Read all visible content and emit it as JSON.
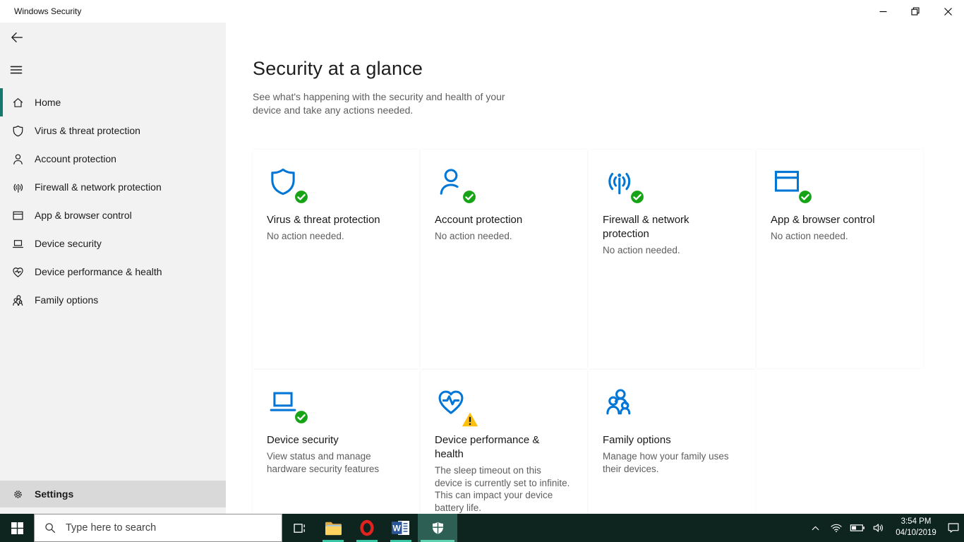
{
  "window": {
    "title": "Windows Security",
    "controls": [
      "minimize",
      "restore",
      "close"
    ]
  },
  "sidebar": {
    "items": [
      {
        "label": "Home",
        "icon": "home-icon",
        "selected": true
      },
      {
        "label": "Virus & threat protection",
        "icon": "shield-icon",
        "selected": false
      },
      {
        "label": "Account protection",
        "icon": "person-icon",
        "selected": false
      },
      {
        "label": "Firewall & network protection",
        "icon": "network-icon",
        "selected": false
      },
      {
        "label": "App & browser control",
        "icon": "app-browser-icon",
        "selected": false
      },
      {
        "label": "Device security",
        "icon": "laptop-icon",
        "selected": false
      },
      {
        "label": "Device performance & health",
        "icon": "health-heart-icon",
        "selected": false
      },
      {
        "label": "Family options",
        "icon": "family-icon",
        "selected": false
      }
    ],
    "settings": {
      "label": "Settings",
      "icon": "gear-icon"
    }
  },
  "main": {
    "title": "Security at a glance",
    "subtitle": "See what's happening with the security and health of your device and take any actions needed.",
    "tiles": [
      {
        "title": "Virus & threat protection",
        "description": "No action needed.",
        "icon": "shield-icon",
        "status": "ok"
      },
      {
        "title": "Account protection",
        "description": "No action needed.",
        "icon": "person-icon",
        "status": "ok"
      },
      {
        "title": "Firewall & network protection",
        "description": "No action needed.",
        "icon": "network-icon",
        "status": "ok"
      },
      {
        "title": "App & browser control",
        "description": "No action needed.",
        "icon": "app-browser-icon",
        "status": "ok"
      },
      {
        "title": "Device security",
        "description": "View status and manage hardware security features",
        "icon": "laptop-icon",
        "status": "ok"
      },
      {
        "title": "Device performance & health",
        "description": "The sleep timeout on this device is currently set to infinite. This can impact your device battery life.",
        "icon": "health-heart-icon",
        "status": "warning"
      },
      {
        "title": "Family options",
        "description": "Manage how your family uses their devices.",
        "icon": "family-icon",
        "status": "none"
      }
    ]
  },
  "taskbar": {
    "start": {
      "icon": "windows-start-icon"
    },
    "search": {
      "placeholder": "Type here to search",
      "icon": "search-icon"
    },
    "apps": [
      {
        "name": "task-view",
        "icon": "task-view-icon",
        "running": false,
        "active": false
      },
      {
        "name": "file-explorer",
        "icon": "folder-icon",
        "running": true,
        "active": false
      },
      {
        "name": "opera",
        "icon": "opera-icon",
        "running": true,
        "active": false
      },
      {
        "name": "word",
        "icon": "word-icon",
        "running": true,
        "active": false
      },
      {
        "name": "windows-security",
        "icon": "security-shield-icon",
        "running": true,
        "active": true
      }
    ],
    "tray": {
      "icons": [
        "chevron-up-icon",
        "wifi-icon",
        "battery-icon",
        "volume-icon"
      ],
      "time": "3:54 PM",
      "date": "04/10/2019",
      "action_center_icon": "action-center-icon"
    }
  },
  "colors": {
    "accent_teal": "#17786d",
    "taskbar_bg": "#0d241f",
    "taskbar_active_bg": "#2d5f55",
    "running_indicator": "#38c7a4",
    "icon_blue": "#0076d7",
    "status_ok_green": "#16a316",
    "status_warning_yellow": "#fcc10e",
    "sidebar_bg": "#f2f2f2",
    "settings_row_bg": "#d9d9d9"
  }
}
